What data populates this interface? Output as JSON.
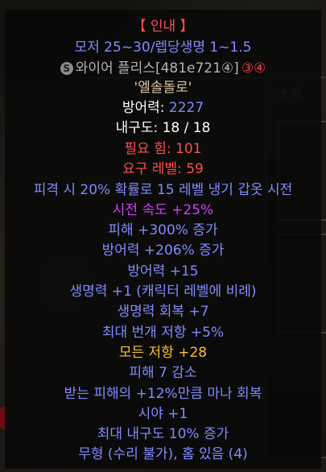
{
  "background": {
    "panel_title": "소지"
  },
  "item": {
    "grade_label": "【 인내 】",
    "subtitle": "모저 25~30/렙당생명 1~1.5",
    "socket_icon": "S",
    "socket_text": "와이어 플리스[481e721④]",
    "socket_badges": "③④",
    "runeword": "'엘솔돌로'",
    "defense_label": "방어력:",
    "defense_value": "2227",
    "durability": "내구도: 18 / 18",
    "req_strength": "필요 힘: 101",
    "req_level": "요구 레벨: 59",
    "props": [
      "피격 시 20% 확률로 15 레벨 냉기 갑옷 시전",
      "시전 속도 +25%",
      "피해 +300% 증가",
      "방어력 +206% 증가",
      "방어력 +15",
      "생명력 +1 (캐릭터 레벨에 비례)",
      "생명력 회복 +7",
      "최대 번개 저항 +5%",
      "모든 저항 +28",
      "피해 7 감소",
      "받는 피해의 +12%만큼 마나 회복",
      "시야 +1",
      "최대 내구도 10% 증가",
      "무형 (수리 불가), 홈 있음 (4)"
    ]
  },
  "colors": {
    "title": "#ff4e4e",
    "magic": "#7f8cff",
    "normal": "#ffffff",
    "socketed": "#b5b5b5",
    "cast": "#d63cff",
    "resist": "#ffbf2e",
    "runeword": "#ddc7a2"
  }
}
